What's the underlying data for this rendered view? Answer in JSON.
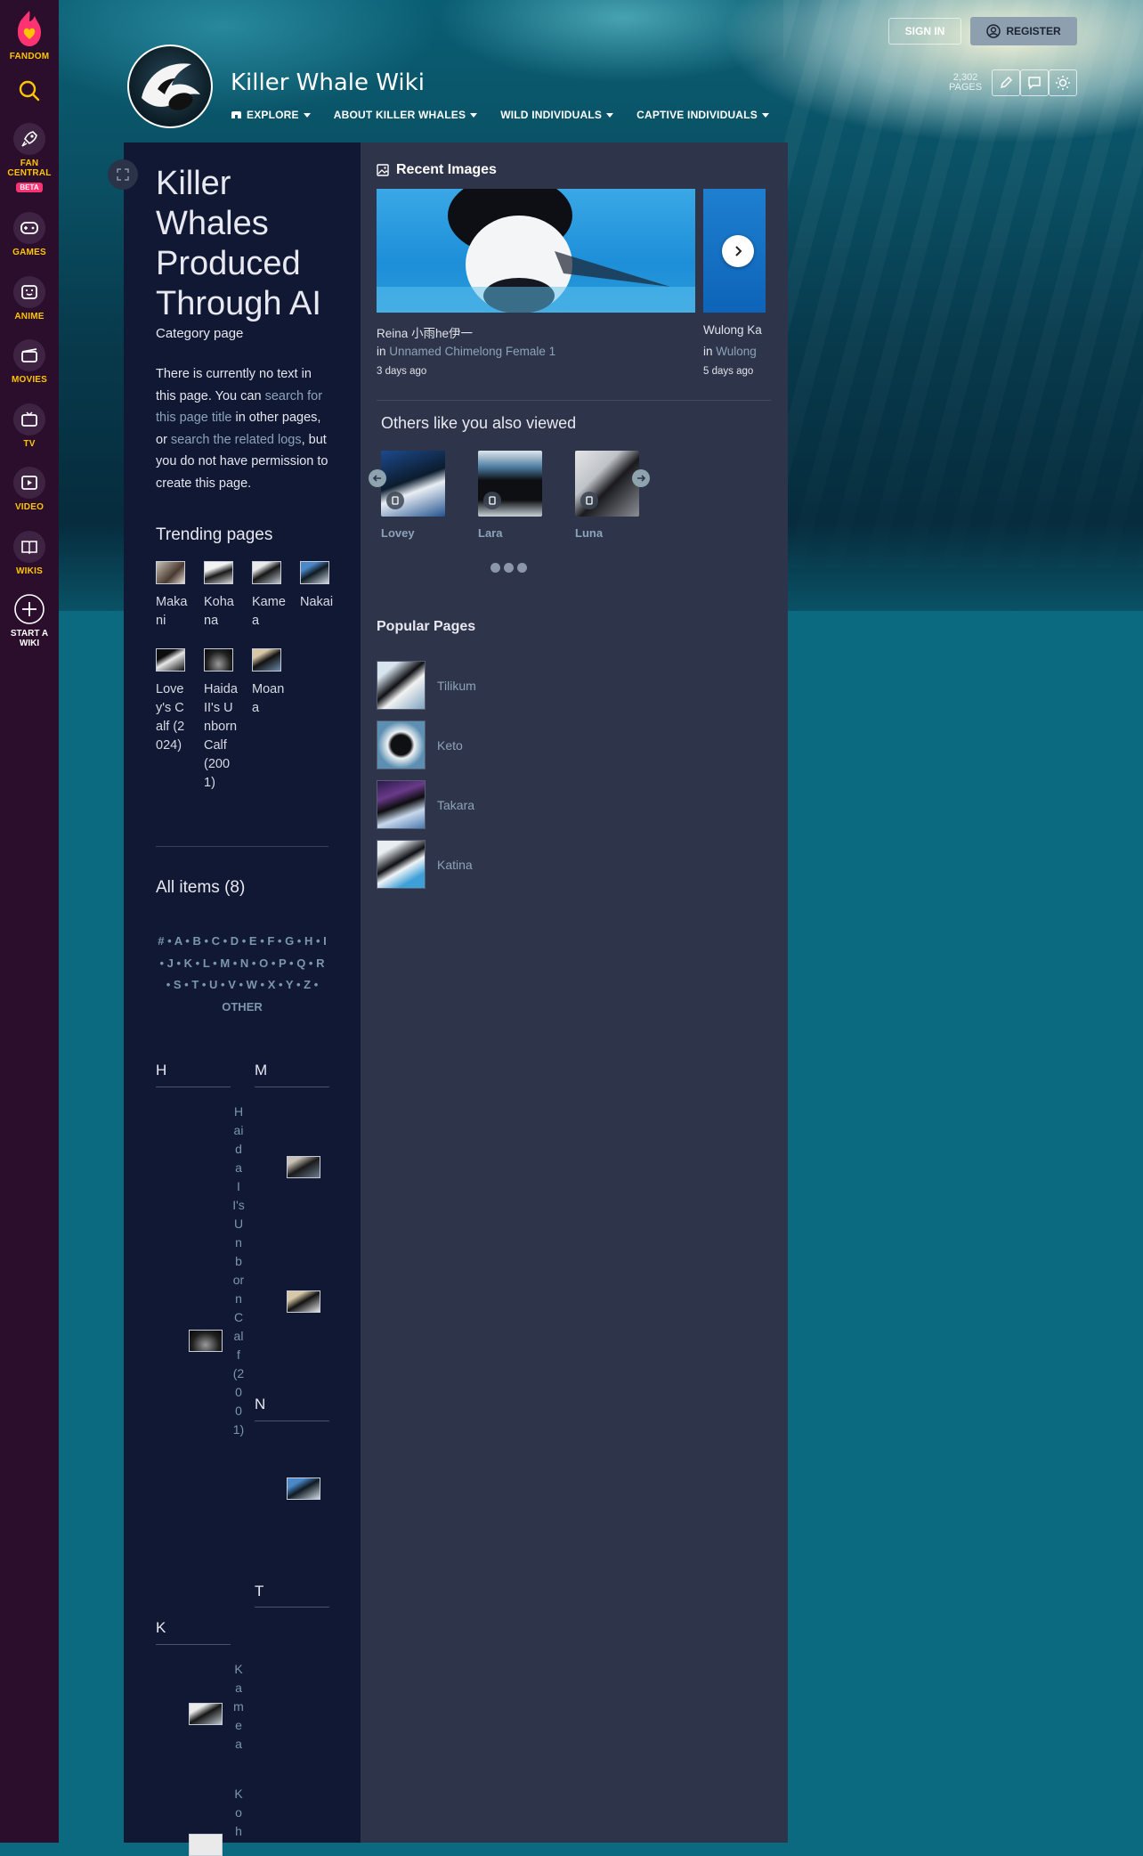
{
  "rail": {
    "fandom_label": "FANDOM",
    "fan_central_label": "FAN CENTRAL",
    "beta_label": "BETA",
    "games_label": "GAMES",
    "anime_label": "ANIME",
    "movies_label": "MOVIES",
    "tv_label": "TV",
    "video_label": "VIDEO",
    "wikis_label": "WIKIS",
    "start_wiki_label": "START A WIKI"
  },
  "header": {
    "wiki_title": "Killer Whale Wiki",
    "nav": [
      "EXPLORE",
      "ABOUT KILLER WHALES",
      "WILD INDIVIDUALS",
      "CAPTIVE INDIVIDUALS"
    ],
    "sign_in": "SIGN IN",
    "register": "REGISTER",
    "pages_count": "2,302",
    "pages_label": "PAGES"
  },
  "page": {
    "title": "Killer Whales Produced Through AI",
    "subtitle": "Category page",
    "body_1": "There is currently no text in this page. You can ",
    "link_search_title": "search for this page title",
    "body_2": " in other pages, or ",
    "link_search_logs": "search the related logs",
    "body_3": ", but you do not have permission to create this page."
  },
  "trending": {
    "heading": "Trending pages",
    "items": [
      "Makani",
      "Kohana",
      "Kamea",
      "Nakai",
      "Lovey's Calf (2024)",
      "Haida II's Unborn Calf (2001)",
      "Moana"
    ]
  },
  "all_items": {
    "heading": "All items (8)",
    "alphabet_line_1": "# • A • B • C • D • E • F • G • H • I",
    "alphabet_line_2": "• J • K • L • M • N • O • P • Q • R",
    "alphabet_line_3": "• S • T • U • V • W • X • Y • Z •",
    "other": "OTHER",
    "columns": {
      "h": "H",
      "m": "M",
      "n": "N",
      "t": "T",
      "k": "K"
    },
    "entries": {
      "h_1": "Haida II's Unborn Calf (2001)",
      "k_1": "Kamea",
      "k_2": "Koh"
    }
  },
  "recent_images": {
    "heading": "Recent Images",
    "items": [
      {
        "title": "Reina 小雨he伊一",
        "in_label": "in",
        "page": "Unnamed Chimelong Female 1",
        "time": "3 days ago"
      },
      {
        "title": "Wulong Ka",
        "in_label": "in",
        "page": "Wulong",
        "time": "5 days ago"
      }
    ]
  },
  "others_viewed": {
    "heading": "Others like you also viewed",
    "items": [
      "Lovey",
      "Lara",
      "Luna"
    ]
  },
  "popular_pages": {
    "heading": "Popular Pages",
    "items": [
      "Tilikum",
      "Keto",
      "Takara",
      "Katina"
    ]
  }
}
